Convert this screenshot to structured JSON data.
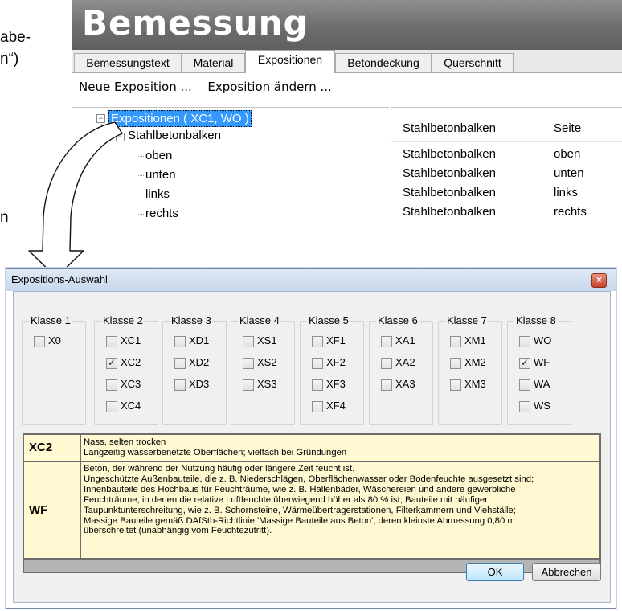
{
  "side_text": {
    "line1": "abe-",
    "line2": "n“)",
    "line3": "n"
  },
  "top_window": {
    "title": "Bemessung",
    "tabs": [
      {
        "label": "Bemessungstext"
      },
      {
        "label": "Material"
      },
      {
        "label": "Expositionen"
      },
      {
        "label": "Betondeckung"
      },
      {
        "label": "Querschnitt"
      }
    ],
    "toolbar": {
      "new_exposition": "Neue Exposition ...",
      "edit_exposition": "Exposition ändern ..."
    },
    "tree": {
      "root": "Expositionen ( XC1, WO )",
      "child": "Stahlbetonbalken",
      "leaves": [
        "oben",
        "unten",
        "links",
        "rechts"
      ]
    },
    "list": {
      "headers": [
        "Stahlbetonbalken",
        "Seite"
      ],
      "rows": [
        [
          "Stahlbetonbalken",
          "oben"
        ],
        [
          "Stahlbetonbalken",
          "unten"
        ],
        [
          "Stahlbetonbalken",
          "links"
        ],
        [
          "Stahlbetonbalken",
          "rechts"
        ]
      ]
    }
  },
  "dialog": {
    "title": "Expositions-Auswahl",
    "groups": [
      {
        "label": "Klasse 1",
        "items": [
          {
            "label": "X0",
            "checked": false
          }
        ]
      },
      {
        "label": "Klasse 2",
        "items": [
          {
            "label": "XC1",
            "checked": false
          },
          {
            "label": "XC2",
            "checked": true
          },
          {
            "label": "XC3",
            "checked": false
          },
          {
            "label": "XC4",
            "checked": false
          }
        ]
      },
      {
        "label": "Klasse 3",
        "items": [
          {
            "label": "XD1",
            "checked": false
          },
          {
            "label": "XD2",
            "checked": false
          },
          {
            "label": "XD3",
            "checked": false
          }
        ]
      },
      {
        "label": "Klasse 4",
        "items": [
          {
            "label": "XS1",
            "checked": false
          },
          {
            "label": "XS2",
            "checked": false
          },
          {
            "label": "XS3",
            "checked": false
          }
        ]
      },
      {
        "label": "Klasse 5",
        "items": [
          {
            "label": "XF1",
            "checked": false
          },
          {
            "label": "XF2",
            "checked": false
          },
          {
            "label": "XF3",
            "checked": false
          },
          {
            "label": "XF4",
            "checked": false
          }
        ]
      },
      {
        "label": "Klasse 6",
        "items": [
          {
            "label": "XA1",
            "checked": false
          },
          {
            "label": "XA2",
            "checked": false
          },
          {
            "label": "XA3",
            "checked": false
          }
        ]
      },
      {
        "label": "Klasse 7",
        "items": [
          {
            "label": "XM1",
            "checked": false
          },
          {
            "label": "XM2",
            "checked": false
          },
          {
            "label": "XM3",
            "checked": false
          }
        ]
      },
      {
        "label": "Klasse 8",
        "items": [
          {
            "label": "WO",
            "checked": false
          },
          {
            "label": "WF",
            "checked": true
          },
          {
            "label": "WA",
            "checked": false
          },
          {
            "label": "WS",
            "checked": false
          }
        ]
      }
    ],
    "info": [
      {
        "code": "XC2",
        "lines": [
          "Nass, selten trocken",
          "Langzeitig wasserbenetzte Oberflächen; vielfach bei Gründungen"
        ]
      },
      {
        "code": "WF",
        "lines": [
          "Beton, der während der Nutzung häufig oder längere Zeit feucht ist.",
          "Ungeschützte Außenbauteile, die z. B. Niederschlägen, Oberflächenwasser oder Bodenfeuchte ausgesetzt sind;",
          "Innenbauteile des Hochbaus für Feuchträume, wie z. B. Hallenbäder, Wäschereien und andere gewerbliche",
          "Feuchträume, in denen die relative Luftfeuchte überwiegend höher als 80 % ist; Bauteile mit häufiger",
          "Taupunktunterschreitung, wie z. B. Schornsteine, Wärmeübertragerstationen, Filterkammern und Viehställe;",
          "Massige Bauteile gemäß DAfStb-Richtlinie 'Massige Bauteile aus Beton', deren kleinste Abmessung 0,80 m",
          "überschreitet (unabhängig vom Feuchtezutritt)."
        ]
      }
    ],
    "buttons": {
      "ok": "OK",
      "cancel": "Abbrechen"
    }
  }
}
